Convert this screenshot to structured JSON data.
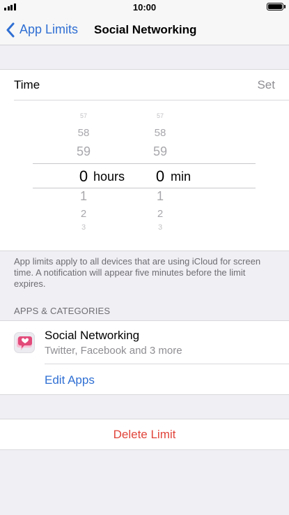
{
  "status_bar": {
    "time": "10:00"
  },
  "nav": {
    "back_label": "App Limits",
    "title": "Social Networking"
  },
  "time": {
    "label": "Time",
    "action": "Set"
  },
  "picker": {
    "hours": {
      "above": [
        "57",
        "58",
        "59"
      ],
      "selected": "0",
      "below": [
        "1",
        "2",
        "3"
      ],
      "unit": "hours"
    },
    "minutes": {
      "above": [
        "57",
        "58",
        "59"
      ],
      "selected": "0",
      "below": [
        "1",
        "2",
        "3"
      ],
      "unit": "min"
    }
  },
  "info_text": "App limits apply to all devices that are using iCloud for screen time. A notification will appear five minutes before the limit expires.",
  "apps_section": {
    "header": "APPS & CATEGORIES",
    "item": {
      "name": "Social Networking",
      "subtitle": "Twitter, Facebook and 3 more",
      "icon": "social-networking-icon"
    },
    "edit_label": "Edit Apps"
  },
  "delete_label": "Delete Limit",
  "colors": {
    "accent": "#2f6fd3",
    "destructive": "#e0443a",
    "background": "#efeff4"
  }
}
